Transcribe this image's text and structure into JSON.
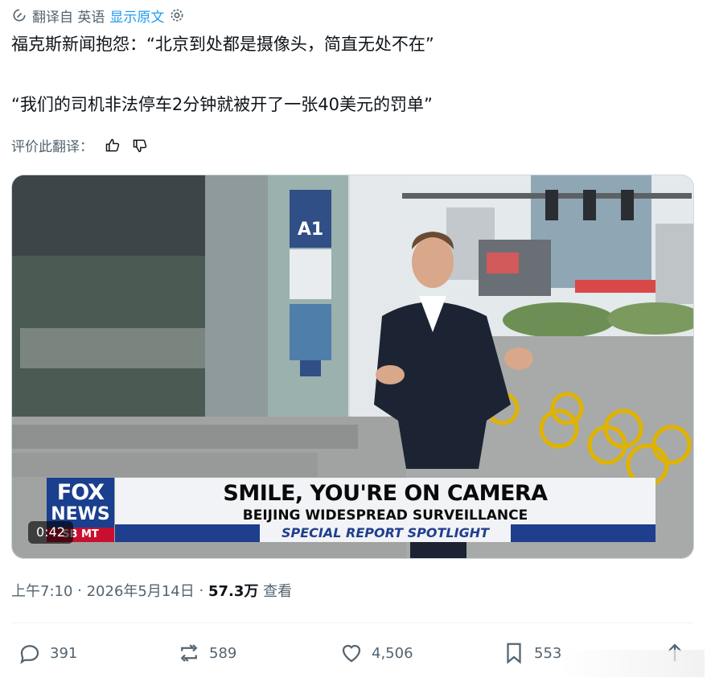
{
  "translate_bar": {
    "label": "翻译自 英语",
    "show_original": "显示原文"
  },
  "tweet": {
    "line1": "福克斯新闻抱怨：“北京到处都是摄像头，简直无处不在”",
    "line2": "“我们的司机非法停车2分钟就被开了一张40美元的罚单”"
  },
  "rate": {
    "label": "评价此翻译："
  },
  "media": {
    "station_sign": "A1",
    "fox_logo": [
      "FOX",
      "NEWS",
      "SB MT"
    ],
    "headline": "SMILE, YOU'RE ON CAMERA",
    "subheadline": "BEIJING WIDESPREAD SURVEILLANCE",
    "strip": "SPECIAL REPORT SPOTLIGHT",
    "duration": "0:42"
  },
  "meta": {
    "time": "上午7:10",
    "sep": " · ",
    "date": "2026年5月14日",
    "views": "57.3万",
    "views_label": " 查看"
  },
  "actions": {
    "replies": "391",
    "reposts": "589",
    "likes": "4,506",
    "bookmarks": "553"
  },
  "colors": {
    "accent": "#1d9bf0",
    "muted": "#536471",
    "fox_blue": "#1a3f8f",
    "fox_red": "#c8102e"
  }
}
